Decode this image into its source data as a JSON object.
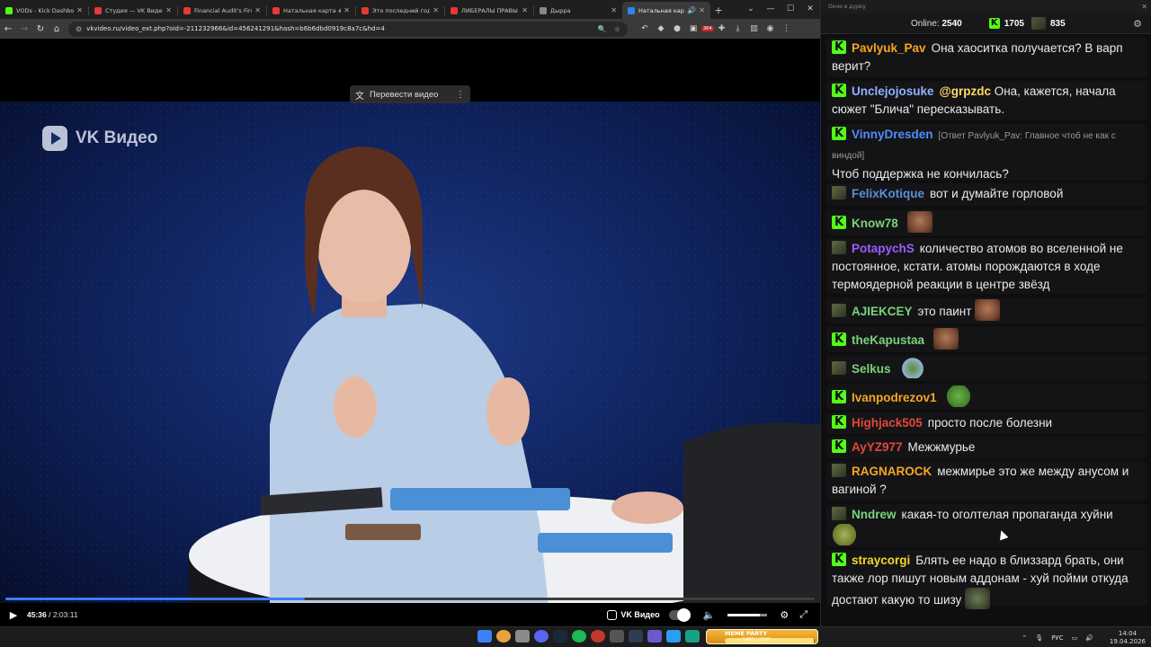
{
  "browser": {
    "tabs": [
      {
        "label": "VODs - Kick Dashboard",
        "color": "#53fc18"
      },
      {
        "label": "Студия — VK Видео Li",
        "color": "#e53935"
      },
      {
        "label": "Financial Audit's First F",
        "color": "#e53935"
      },
      {
        "label": "Натальная карта #58 А",
        "color": "#e53935"
      },
      {
        "label": "Это последний год Пу",
        "color": "#e53935"
      },
      {
        "label": "ЛИБЕРАЛЫ ПРАВЫ ВС",
        "color": "#e53935"
      },
      {
        "label": "Дырра",
        "color": "#888888"
      },
      {
        "label": "Натальная карта #",
        "color": "#2787f5",
        "active": true
      }
    ],
    "url": "vkvideo.ru/video_ext.php?oid=-211232966&id=456241291&hash=b6b6dbd0919c8a7c&hd=4",
    "extension_badge": "364"
  },
  "player": {
    "watermark": "VK Видео",
    "translate_label": "Перевести видео",
    "time_current": "45:36",
    "time_sep": " / ",
    "time_total": "2:03:11",
    "progress_fraction": 0.37,
    "brand_button": "VK Видео",
    "volume_fraction": 0.8
  },
  "chat": {
    "window_title": "Окно в дурку",
    "online_label": "Online:",
    "online_count": "2540",
    "kick_count": "1705",
    "avatar_count": "835",
    "messages": [
      {
        "badge": "k",
        "user": "Pavlyuk_Pav",
        "color": "#f5a623",
        "text": "Она хаоситка получается? В варп верит?"
      },
      {
        "badge": "k",
        "user": "Unclejojosuke",
        "color": "#8fb3ff",
        "mention": "@grpzdc",
        "text": "Она, кажется, начала сюжет \"Блича\" пересказывать."
      },
      {
        "badge": "k",
        "user": "VinnyDresden",
        "color": "#4f8cff",
        "reply": "[Ответ Pavlyuk_Pav: Главное чтоб не как с виндой]",
        "text": "Чтоб поддержка не кончилась?"
      },
      {
        "badge": "s",
        "user": "FelixKotique",
        "color": "#5b8fd6",
        "text": "вот и думайте горловой"
      },
      {
        "badge": "k",
        "user": "Know78",
        "color": "#7ad27a",
        "text": "",
        "emote": "em-face"
      },
      {
        "badge": "s",
        "user": "PotapychS",
        "color": "#9c5cff",
        "text": "количество атомов во вселенной не постоянное, кстати. атомы порождаются в ходе термоядерной реакции в центре звёзд"
      },
      {
        "badge": "s",
        "user": "AJIEKCEY",
        "color": "#7ad27a",
        "text": "это паинт",
        "emote": "em-face"
      },
      {
        "badge": "k",
        "user": "theKapustaa",
        "color": "#7ad27a",
        "text": "",
        "emote": "em-face"
      },
      {
        "badge": "s",
        "user": "Selkus",
        "color": "#7ad27a",
        "text": "",
        "emote": "em-frog2"
      },
      {
        "badge": "k",
        "user": "Ivanpodrezov1",
        "color": "#f5a623",
        "text": "",
        "emote": "em-frog"
      },
      {
        "badge": "k",
        "user": "Highjack505",
        "color": "#e2483b",
        "text": "просто после болезни"
      },
      {
        "badge": "k",
        "user": "AyYZ977",
        "color": "#e2483b",
        "text": "Межжмурье"
      },
      {
        "badge": "s",
        "user": "RAGNAROCK",
        "color": "#f5a623",
        "text": "межмирье это же между анусом и вагиной ?"
      },
      {
        "badge": "s",
        "user": "Nndrew",
        "color": "#7ad27a",
        "text": "какая-то оголтелая пропаганда хуйни",
        "emote": "em-pepe"
      },
      {
        "badge": "k",
        "user": "straycorgi",
        "color": "#f5d523",
        "text": "Блять ее надо в близзард брать, они также лор пишут новым аддонам - хуй пойми откуда достают какую то шизу",
        "emote": "em-gray"
      }
    ]
  },
  "taskbar": {
    "meme_title": "MEME PARTY",
    "meme_progress_text": "1487 / 1500",
    "meme_fraction": 0.99,
    "lang": "РУС",
    "time": "14:04",
    "date": "19.04.2026"
  }
}
